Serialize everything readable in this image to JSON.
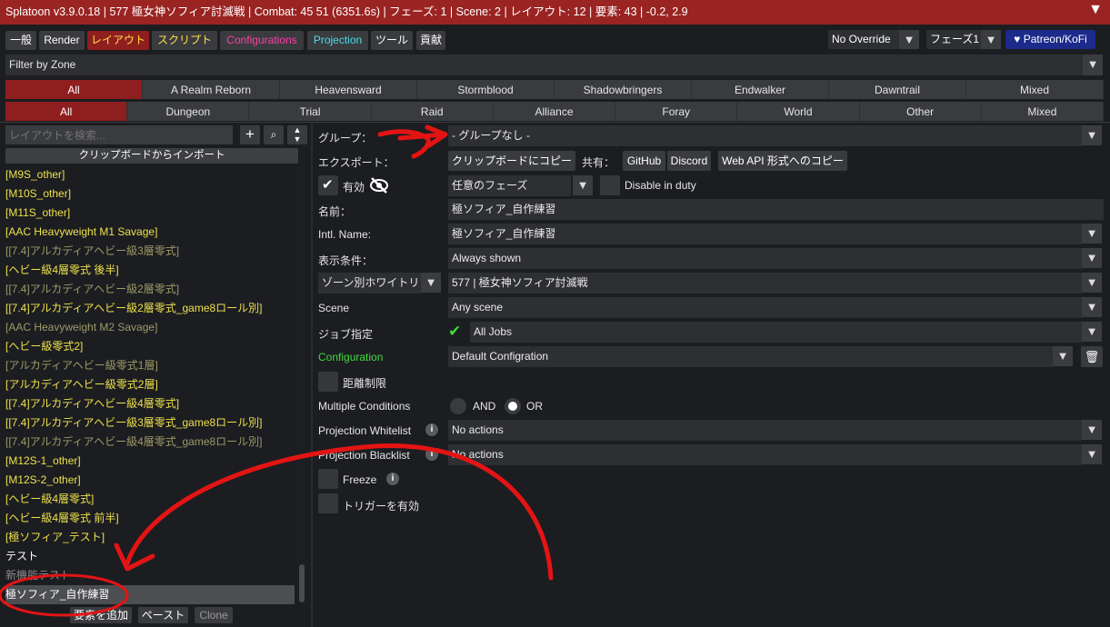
{
  "window": {
    "title": "Splatoon v3.9.0.18 | 577 極女神ソフィア討滅戦 | Combat: 45 51 (6351.6s) | フェーズ: 1 | Scene: 2 | レイアウト: 12 | 要素: 43 | -0.2, 2.9",
    "close": "▼"
  },
  "tabs": [
    "一般",
    "Render",
    "レイアウト",
    "スクリプト",
    "Configurations",
    "Projection",
    "ツール",
    "貢献"
  ],
  "tab_colors": [
    "#ffffff",
    "#ffffff",
    "#ffe04b",
    "#ffe04b",
    "#ff3ea5",
    "#4fd8e6",
    "#ffffff",
    "#ffffff"
  ],
  "override": {
    "label": "No Override",
    "phase": "フェーズ1",
    "patreon": "♥ Patreon/KoFi"
  },
  "filter": {
    "label": "Filter by Zone"
  },
  "expansions": [
    "All",
    "A Realm Reborn",
    "Heavensward",
    "Stormblood",
    "Shadowbringers",
    "Endwalker",
    "Dawntrail",
    "Mixed"
  ],
  "contents": [
    "All",
    "Dungeon",
    "Trial",
    "Raid",
    "Alliance",
    "Foray",
    "World",
    "Other",
    "Mixed"
  ],
  "left": {
    "search_placeholder": "レイアウトを検索...",
    "import_label": "クリップボードからインポート",
    "items": [
      {
        "label": "[M9S_other]",
        "style": "yellow"
      },
      {
        "label": "[M10S_other]",
        "style": "yellow"
      },
      {
        "label": "[M11S_other]",
        "style": "yellow"
      },
      {
        "label": "[AAC Heavyweight M1 Savage]",
        "style": "yellow"
      },
      {
        "label": "[[7.4]アルカディアヘビー級3層零式]",
        "style": "dim"
      },
      {
        "label": "[ヘビー級4層零式 後半]",
        "style": "yellow"
      },
      {
        "label": "[[7.4]アルカディアヘビー級2層零式]",
        "style": "dim"
      },
      {
        "label": "[[7.4]アルカディアヘビー級2層零式_game8ロール別]",
        "style": "yellow"
      },
      {
        "label": "[AAC Heavyweight M2 Savage]",
        "style": "dim"
      },
      {
        "label": "[ヘビー級零式2]",
        "style": "yellow"
      },
      {
        "label": "[アルカディアヘビー級零式1層]",
        "style": "dim"
      },
      {
        "label": "[アルカディアヘビー級零式2層]",
        "style": "yellow"
      },
      {
        "label": "[[7.4]アルカディアヘビー級4層零式]",
        "style": "yellow"
      },
      {
        "label": "[[7.4]アルカディアヘビー級3層零式_game8ロール別]",
        "style": "yellow"
      },
      {
        "label": "[[7.4]アルカディアヘビー級4層零式_game8ロール別]",
        "style": "dim"
      },
      {
        "label": "[M12S-1_other]",
        "style": "yellow"
      },
      {
        "label": "[M12S-2_other]",
        "style": "yellow"
      },
      {
        "label": "[ヘビー級4層零式]",
        "style": "yellow"
      },
      {
        "label": "[ヘビー級4層零式 前半]",
        "style": "yellow"
      },
      {
        "label": "[極ソフィア_テスト]",
        "style": "yellow"
      },
      {
        "label": "テスト",
        "style": "white"
      },
      {
        "label": "新機能テスト",
        "style": "grey"
      },
      {
        "label": "極ソフィア_自作練習",
        "style": "sel"
      }
    ],
    "bottom": {
      "add": "要素を追加",
      "paste": "ペースト",
      "clone": "Clone"
    }
  },
  "right": {
    "group": {
      "label": "グループ：",
      "value": "- グループなし -"
    },
    "export": {
      "label": "エクスポート：",
      "copy": "クリップボードにコピー",
      "share": "共有：",
      "github": "GitHub",
      "discord": "Discord",
      "webapi": "Web API 形式へのコピー"
    },
    "enabled": {
      "label": "有効",
      "phase": "任意のフェーズ",
      "disable_duty": "Disable in duty"
    },
    "name": {
      "label": "名前：",
      "value": "極ソフィア_自作練習"
    },
    "intl": {
      "label": "Intl. Name:",
      "value": "極ソフィア_自作練習"
    },
    "display": {
      "label": "表示条件：",
      "value": "Always shown"
    },
    "zone": {
      "label": "ゾーン別ホワイトリ",
      "value": "577 | 極女神ソフィア討滅戦"
    },
    "scene": {
      "label": "Scene",
      "value": "Any scene"
    },
    "job": {
      "label": "ジョブ指定",
      "value": "All Jobs"
    },
    "config": {
      "label": "Configuration",
      "value": "Default Configration",
      "color": "#3fdc3f"
    },
    "distance": {
      "label": "距離制限"
    },
    "multiple": {
      "label": "Multiple Conditions",
      "and": "AND",
      "or": "OR"
    },
    "whitelist": {
      "label": "Projection Whitelist",
      "value": "No actions"
    },
    "blacklist": {
      "label": "Projection Blacklist",
      "value": "No actions"
    },
    "freeze": {
      "label": "Freeze"
    },
    "trigger": {
      "label": "トリガーを有効"
    }
  }
}
